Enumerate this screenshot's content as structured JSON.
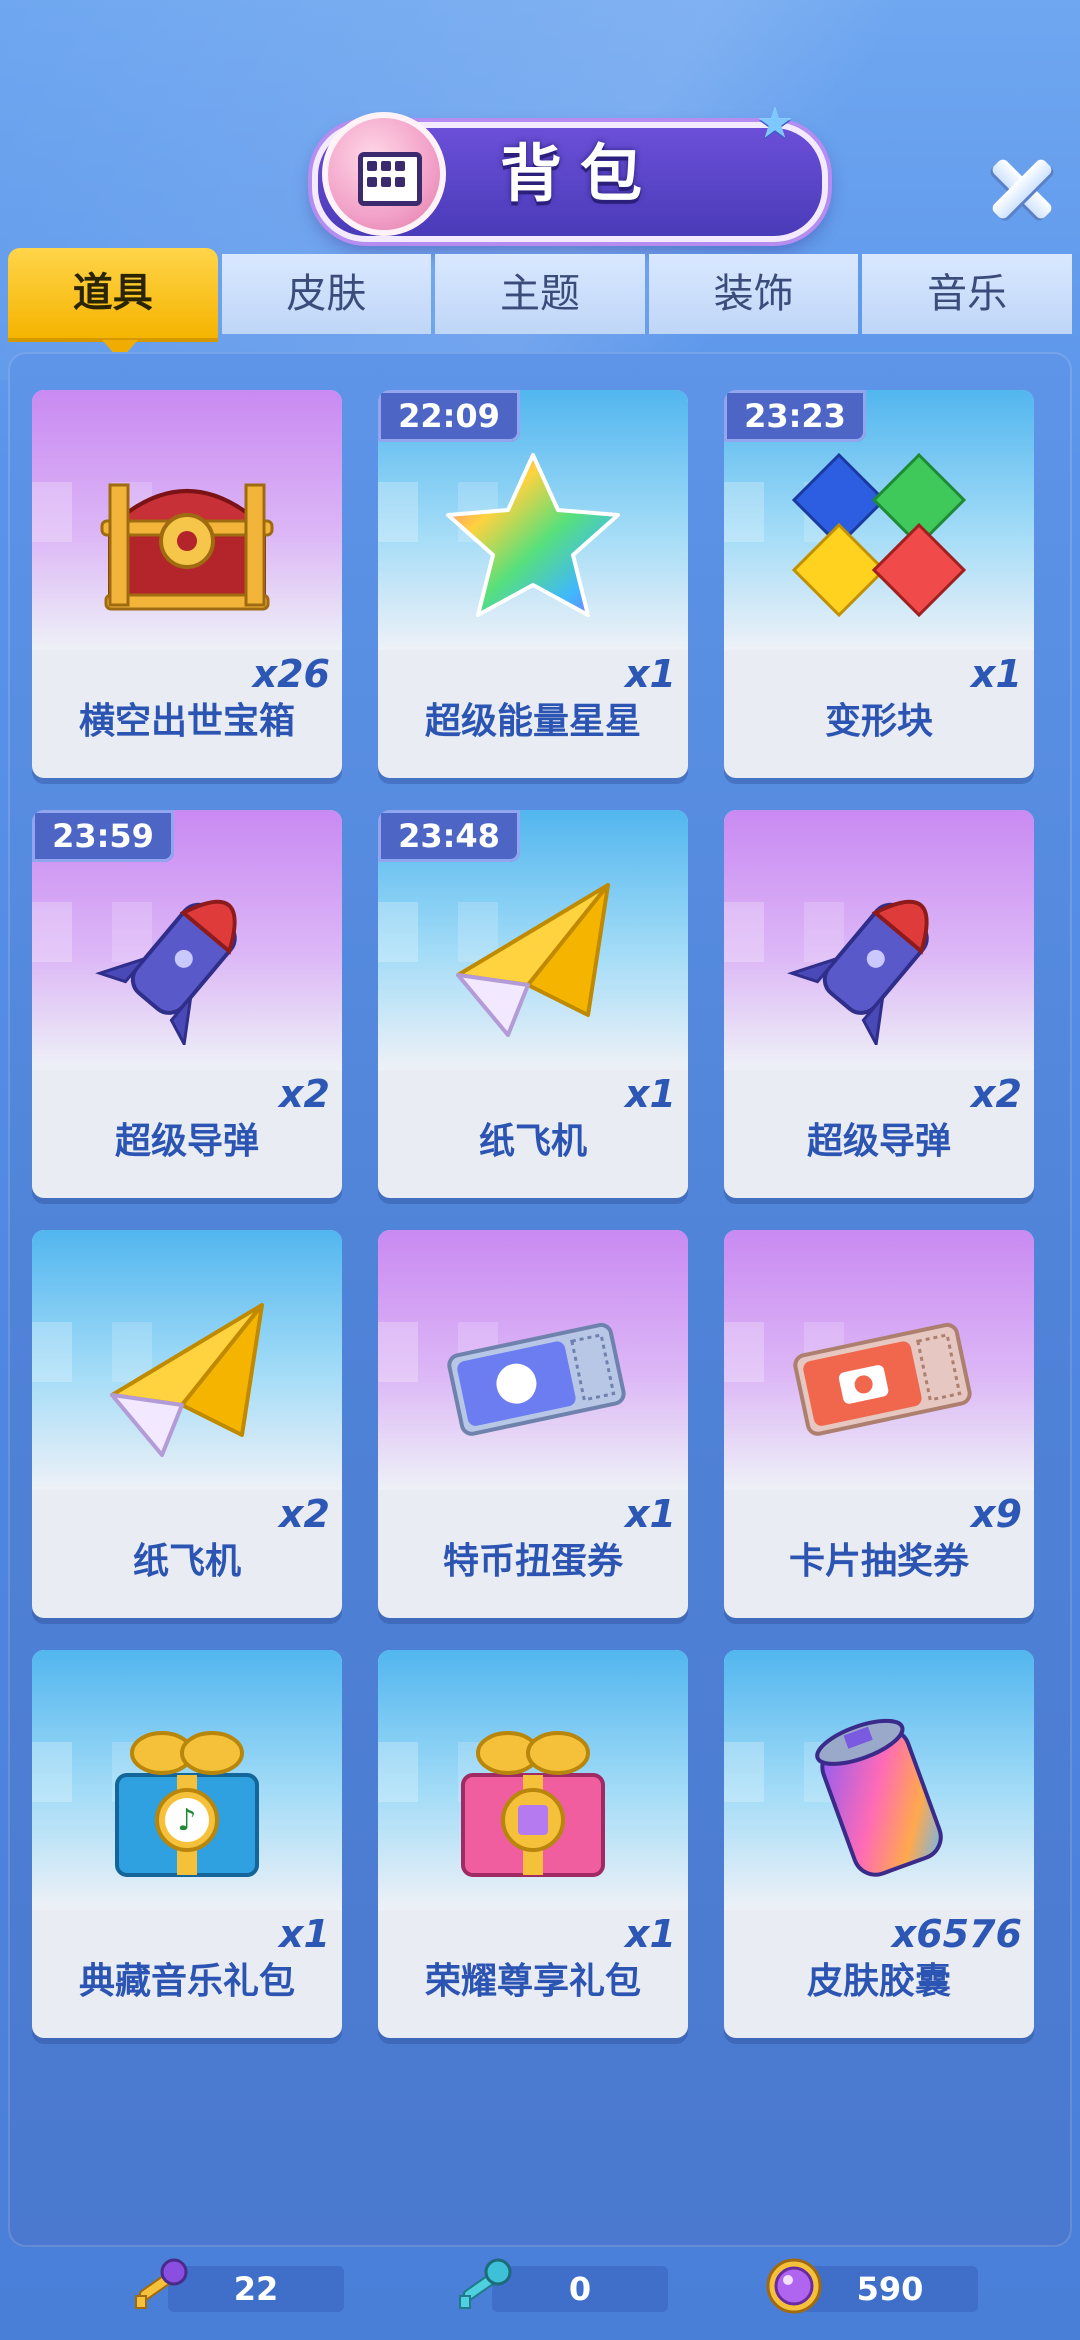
{
  "header": {
    "title": "背包",
    "close_icon": "close-icon",
    "backpack_icon": "backpack-icon"
  },
  "tabs": [
    {
      "label": "道具",
      "active": true
    },
    {
      "label": "皮肤",
      "active": false
    },
    {
      "label": "主题",
      "active": false
    },
    {
      "label": "装饰",
      "active": false
    },
    {
      "label": "音乐",
      "active": false
    }
  ],
  "items": [
    {
      "name": "横空出世宝箱",
      "count": "x26",
      "timer": "",
      "icon": "treasure-chest-icon",
      "theme": "purple"
    },
    {
      "name": "超级能量星星",
      "count": "x1",
      "timer": "22:09",
      "icon": "rainbow-star-icon",
      "theme": "blue"
    },
    {
      "name": "变形块",
      "count": "x1",
      "timer": "23:23",
      "icon": "color-blocks-icon",
      "theme": "blue"
    },
    {
      "name": "超级导弹",
      "count": "x2",
      "timer": "23:59",
      "icon": "missile-icon",
      "theme": "purple"
    },
    {
      "name": "纸飞机",
      "count": "x1",
      "timer": "23:48",
      "icon": "paper-plane-icon",
      "theme": "blue"
    },
    {
      "name": "超级导弹",
      "count": "x2",
      "timer": "",
      "icon": "missile-icon",
      "theme": "purple"
    },
    {
      "name": "纸飞机",
      "count": "x2",
      "timer": "",
      "icon": "paper-plane-icon",
      "theme": "blue"
    },
    {
      "name": "特币扭蛋券",
      "count": "x1",
      "timer": "",
      "icon": "coin-ticket-icon",
      "theme": "purple"
    },
    {
      "name": "卡片抽奖券",
      "count": "x9",
      "timer": "",
      "icon": "camera-ticket-icon",
      "theme": "purple"
    },
    {
      "name": "典藏音乐礼包",
      "count": "x1",
      "timer": "",
      "icon": "music-gift-icon",
      "theme": "blue"
    },
    {
      "name": "荣耀尊享礼包",
      "count": "x1",
      "timer": "",
      "icon": "honor-gift-icon",
      "theme": "blue"
    },
    {
      "name": "皮肤胶囊",
      "count": "x6576",
      "timer": "",
      "icon": "skin-capsule-icon",
      "theme": "blue"
    }
  ],
  "currencies": [
    {
      "icon": "purple-key-icon",
      "value": "22"
    },
    {
      "icon": "cyan-key-icon",
      "value": "0"
    },
    {
      "icon": "gem-coin-icon",
      "value": "590"
    }
  ]
}
